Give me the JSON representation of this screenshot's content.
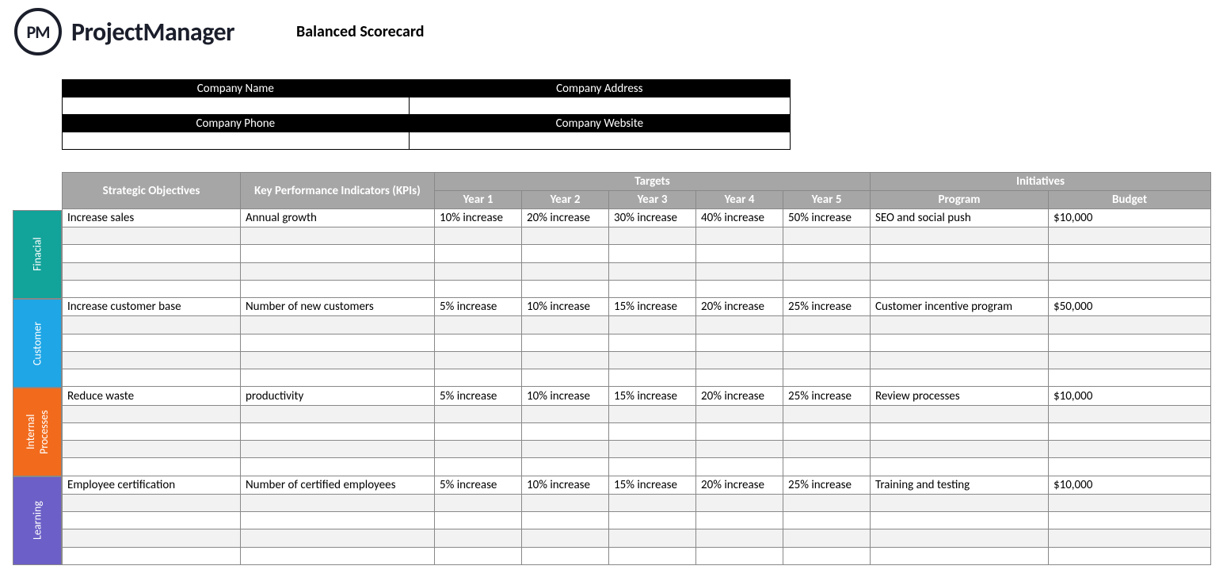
{
  "logo": {
    "badge": "PM",
    "text": "ProjectManager"
  },
  "title": "Balanced Scorecard",
  "companyBox": {
    "row1": {
      "left": "Company Name",
      "right": "Company Address"
    },
    "row2": {
      "left": "Company Phone",
      "right": "Company Website"
    }
  },
  "headers": {
    "objectives": "Strategic Objectives",
    "kpis": "Key Performance Indicators (KPIs)",
    "targets": "Targets",
    "initiatives": "Initiatives",
    "years": [
      "Year 1",
      "Year 2",
      "Year 3",
      "Year 4",
      "Year 5"
    ],
    "program": "Program",
    "budget": "Budget"
  },
  "perspectives": [
    {
      "name": "Finacial",
      "class": "financial",
      "rows": [
        {
          "objective": "Increase sales",
          "kpi": "Annual growth",
          "targets": [
            "10% increase",
            "20% increase",
            "30% increase",
            "40% increase",
            "50% increase"
          ],
          "program": "SEO and social push",
          "budget": "$10,000"
        },
        {
          "objective": "",
          "kpi": "",
          "targets": [
            "",
            "",
            "",
            "",
            ""
          ],
          "program": "",
          "budget": ""
        },
        {
          "objective": "",
          "kpi": "",
          "targets": [
            "",
            "",
            "",
            "",
            ""
          ],
          "program": "",
          "budget": ""
        },
        {
          "objective": "",
          "kpi": "",
          "targets": [
            "",
            "",
            "",
            "",
            ""
          ],
          "program": "",
          "budget": ""
        },
        {
          "objective": "",
          "kpi": "",
          "targets": [
            "",
            "",
            "",
            "",
            ""
          ],
          "program": "",
          "budget": ""
        }
      ]
    },
    {
      "name": "Customer",
      "class": "customer",
      "rows": [
        {
          "objective": "Increase customer base",
          "kpi": "Number of new customers",
          "targets": [
            "5% increase",
            "10% increase",
            "15% increase",
            "20% increase",
            "25% increase"
          ],
          "program": "Customer incentive program",
          "budget": "$50,000"
        },
        {
          "objective": "",
          "kpi": "",
          "targets": [
            "",
            "",
            "",
            "",
            ""
          ],
          "program": "",
          "budget": ""
        },
        {
          "objective": "",
          "kpi": "",
          "targets": [
            "",
            "",
            "",
            "",
            ""
          ],
          "program": "",
          "budget": ""
        },
        {
          "objective": "",
          "kpi": "",
          "targets": [
            "",
            "",
            "",
            "",
            ""
          ],
          "program": "",
          "budget": ""
        },
        {
          "objective": "",
          "kpi": "",
          "targets": [
            "",
            "",
            "",
            "",
            ""
          ],
          "program": "",
          "budget": ""
        }
      ]
    },
    {
      "name": "Internal Processes",
      "class": "internal",
      "rows": [
        {
          "objective": "Reduce waste",
          "kpi": "productivity",
          "targets": [
            "5% increase",
            "10% increase",
            "15% increase",
            "20% increase",
            "25% increase"
          ],
          "program": "Review processes",
          "budget": "$10,000"
        },
        {
          "objective": "",
          "kpi": "",
          "targets": [
            "",
            "",
            "",
            "",
            ""
          ],
          "program": "",
          "budget": ""
        },
        {
          "objective": "",
          "kpi": "",
          "targets": [
            "",
            "",
            "",
            "",
            ""
          ],
          "program": "",
          "budget": ""
        },
        {
          "objective": "",
          "kpi": "",
          "targets": [
            "",
            "",
            "",
            "",
            ""
          ],
          "program": "",
          "budget": ""
        },
        {
          "objective": "",
          "kpi": "",
          "targets": [
            "",
            "",
            "",
            "",
            ""
          ],
          "program": "",
          "budget": ""
        }
      ]
    },
    {
      "name": "Learning",
      "class": "learning",
      "rows": [
        {
          "objective": "Employee certification",
          "kpi": "Number of certified employees",
          "targets": [
            "5% increase",
            "10% increase",
            "15% increase",
            "20% increase",
            "25% increase"
          ],
          "program": "Training and testing",
          "budget": "$10,000"
        },
        {
          "objective": "",
          "kpi": "",
          "targets": [
            "",
            "",
            "",
            "",
            ""
          ],
          "program": "",
          "budget": ""
        },
        {
          "objective": "",
          "kpi": "",
          "targets": [
            "",
            "",
            "",
            "",
            ""
          ],
          "program": "",
          "budget": ""
        },
        {
          "objective": "",
          "kpi": "",
          "targets": [
            "",
            "",
            "",
            "",
            ""
          ],
          "program": "",
          "budget": ""
        },
        {
          "objective": "",
          "kpi": "",
          "targets": [
            "",
            "",
            "",
            "",
            ""
          ],
          "program": "",
          "budget": ""
        }
      ]
    }
  ]
}
